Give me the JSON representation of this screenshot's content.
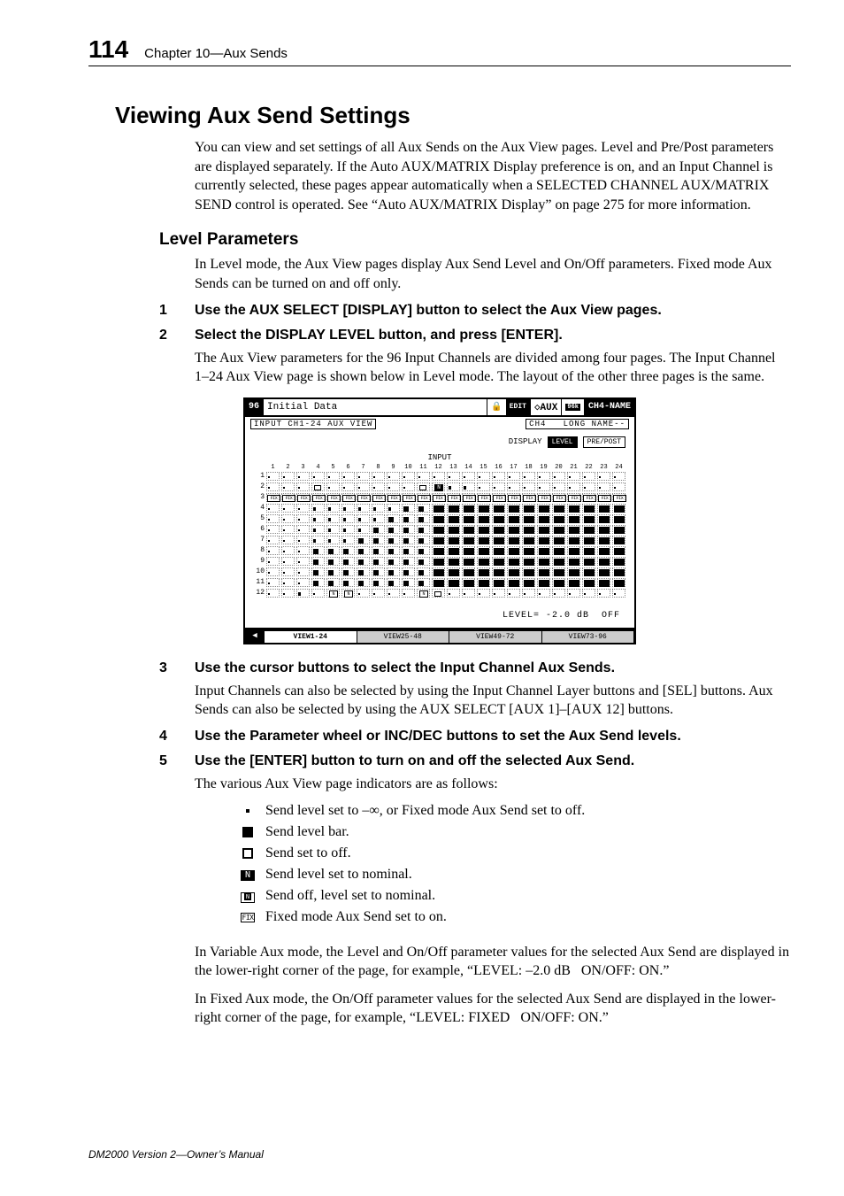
{
  "header": {
    "page_number": "114",
    "chapter": "Chapter 10—Aux Sends"
  },
  "section": {
    "title": "Viewing Aux Send Settings",
    "intro": "You can view and set settings of all Aux Sends on the Aux View pages. Level and Pre/Post parameters are displayed separately. If the Auto AUX/MATRIX Display preference is on, and an Input Channel is currently selected, these pages appear automatically when a SELECTED CHANNEL AUX/MATRIX SEND control is operated. See “Auto AUX/MATRIX Display” on page 275 for more information."
  },
  "level_params": {
    "heading": "Level Parameters",
    "intro": "In Level mode, the Aux View pages display Aux Send Level and On/Off parameters. Fixed mode Aux Sends can be turned on and off only."
  },
  "steps": {
    "s1": {
      "num": "1",
      "text": "Use the AUX SELECT [DISPLAY] button to select the Aux View pages."
    },
    "s2": {
      "num": "2",
      "text": "Select the DISPLAY LEVEL button, and press [ENTER]."
    },
    "s2_body": "The Aux View parameters for the 96 Input Channels are divided among four pages. The Input Channel 1–24 Aux View page is shown below in Level mode. The layout of the other three pages is the same.",
    "s3": {
      "num": "3",
      "text": "Use the cursor buttons to select the Input Channel Aux Sends."
    },
    "s3_body": "Input Channels can also be selected by using the Input Channel Layer buttons and [SEL] buttons. Aux Sends can also be selected by using the AUX SELECT [AUX 1]–[AUX 12] buttons.",
    "s4": {
      "num": "4",
      "text": "Use the Parameter wheel or INC/DEC buttons to set the Aux Send levels."
    },
    "s5": {
      "num": "5",
      "text": "Use the [ENTER] button to turn on and off the selected Aux Send."
    },
    "s5_body": "The various Aux View page indicators are as follows:"
  },
  "indicators": {
    "dot": "Send level set to –∞, or Fixed mode Aux Send set to off.",
    "bar": "Send level bar.",
    "openbox": "Send set to off.",
    "nfilled": "Send level set to nominal.",
    "nopen": "Send off, level set to nominal.",
    "fix": "Fixed mode Aux Send set to on."
  },
  "closing": {
    "p1": "In Variable Aux mode, the Level and On/Off parameter values for the selected Aux Send are displayed in the lower-right corner of the page, for example, “LEVEL: –2.0 dB   ON/OFF: ON.”",
    "p2": "In Fixed Aux mode, the On/Off parameter values for the selected Aux Send are displayed in the lower-right corner of the page, for example, “LEVEL: FIXED   ON/OFF: ON.”"
  },
  "footer": "DM2000 Version 2—Owner’s Manual",
  "lcd": {
    "title_left": "96",
    "title_data": "Initial Data",
    "lock": "🔒",
    "edit": "EDIT",
    "aux": "◇AUX",
    "rate": "96k",
    "ch": "CH4-NAME",
    "row2_left": "INPUT CH1-24 AUX VIEW",
    "row2_right": "CH4   LONG NAME--",
    "display_label": "DISPLAY",
    "btn_level": "LEVEL",
    "btn_prepost": "PRE/POST",
    "input_label": "INPUT",
    "cols": [
      "1",
      "2",
      "3",
      "4",
      "5",
      "6",
      "7",
      "8",
      "9",
      "10",
      "11",
      "12",
      "13",
      "14",
      "15",
      "16",
      "17",
      "18",
      "19",
      "20",
      "21",
      "22",
      "23",
      "24"
    ],
    "rows": [
      "1",
      "2",
      "3",
      "4",
      "5",
      "6",
      "7",
      "8",
      "9",
      "10",
      "11",
      "12"
    ],
    "level_readout": "LEVEL= -2.0 dB  OFF",
    "tabs": {
      "arrow": "◀",
      "t1": "VIEW1-24",
      "t2": "VIEW25-48",
      "t3": "VIEW49-72",
      "t4": "VIEW73-96"
    }
  }
}
